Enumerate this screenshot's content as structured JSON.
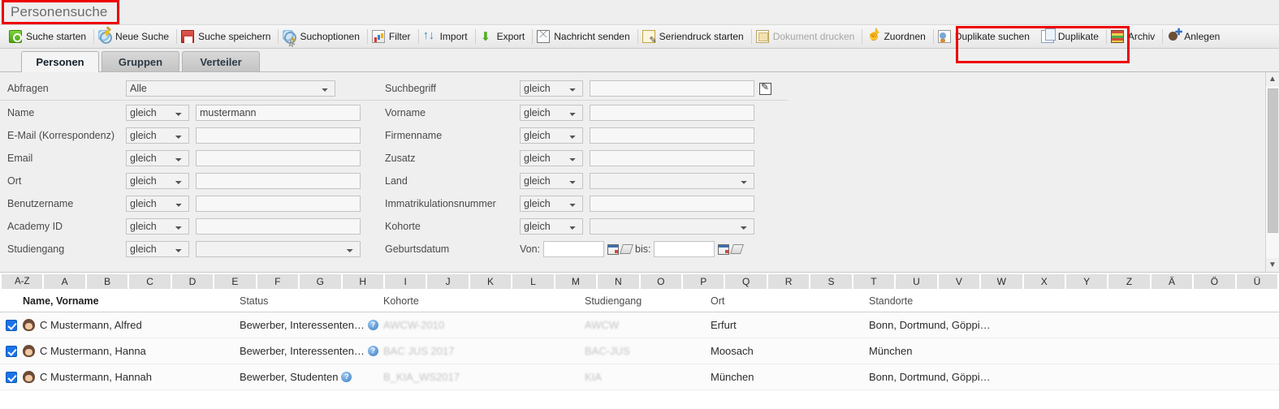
{
  "page": {
    "title": "Personensuche",
    "accent_red": "#ee0000"
  },
  "toolbar": {
    "items": [
      {
        "label": "Suche starten",
        "icon": "search-start-icon",
        "disabled": false,
        "sep_after": true
      },
      {
        "label": "Neue Suche",
        "icon": "new-search-icon",
        "disabled": false,
        "sep_after": true
      },
      {
        "label": "Suche speichern",
        "icon": "save-search-icon",
        "disabled": false,
        "sep_after": true
      },
      {
        "label": "Suchoptionen",
        "icon": "search-options-icon",
        "disabled": false,
        "sep_after": true
      },
      {
        "label": "Filter",
        "icon": "filter-icon",
        "disabled": false,
        "sep_after": true
      },
      {
        "label": "Import",
        "icon": "import-icon",
        "disabled": false,
        "sep_after": true
      },
      {
        "label": "Export",
        "icon": "export-icon",
        "disabled": false,
        "sep_after": true
      },
      {
        "label": "Nachricht senden",
        "icon": "send-message-icon",
        "disabled": false,
        "sep_after": true
      },
      {
        "label": "Seriendruck starten",
        "icon": "mail-merge-icon",
        "disabled": false,
        "sep_after": true
      },
      {
        "label": "Dokument drucken",
        "icon": "print-document-icon",
        "disabled": true,
        "sep_after": true
      },
      {
        "label": "Zuordnen",
        "icon": "assign-icon",
        "disabled": false,
        "sep_after": true
      },
      {
        "label": "Duplikate suchen",
        "icon": "find-duplicates-icon",
        "disabled": false,
        "sep_after": false
      },
      {
        "label": "Duplikate",
        "icon": "duplicates-icon",
        "disabled": false,
        "sep_after": true
      },
      {
        "label": "Archiv",
        "icon": "archive-icon",
        "disabled": false,
        "sep_after": true
      },
      {
        "label": "Anlegen",
        "icon": "create-person-icon",
        "disabled": false,
        "sep_after": false
      }
    ]
  },
  "tabs": [
    {
      "label": "Personen",
      "active": true
    },
    {
      "label": "Gruppen",
      "active": false
    },
    {
      "label": "Verteiler",
      "active": false
    }
  ],
  "form": {
    "abfragen": {
      "label": "Abfragen",
      "value": "Alle"
    },
    "suchbegriff": {
      "label": "Suchbegriff",
      "operator": "gleich",
      "value": ""
    },
    "operator_default": "gleich",
    "left_fields": [
      {
        "label": "Name",
        "operator": "gleich",
        "value": "mustermann",
        "type": "text"
      },
      {
        "label": "E-Mail (Korrespondenz)",
        "operator": "gleich",
        "value": "",
        "type": "text"
      },
      {
        "label": "Email",
        "operator": "gleich",
        "value": "",
        "type": "text"
      },
      {
        "label": "Ort",
        "operator": "gleich",
        "value": "",
        "type": "text"
      },
      {
        "label": "Benutzername",
        "operator": "gleich",
        "value": "",
        "type": "text"
      },
      {
        "label": "Academy ID",
        "operator": "gleich",
        "value": "",
        "type": "text"
      },
      {
        "label": "Studiengang",
        "operator": "gleich",
        "value": "",
        "type": "select"
      }
    ],
    "right_fields": [
      {
        "label": "Vorname",
        "operator": "gleich",
        "value": "",
        "type": "text"
      },
      {
        "label": "Firmenname",
        "operator": "gleich",
        "value": "",
        "type": "text"
      },
      {
        "label": "Zusatz",
        "operator": "gleich",
        "value": "",
        "type": "text"
      },
      {
        "label": "Land",
        "operator": "gleich",
        "value": "",
        "type": "select"
      },
      {
        "label": "Immatrikulationsnummer",
        "operator": "gleich",
        "value": "",
        "type": "text"
      },
      {
        "label": "Kohorte",
        "operator": "gleich",
        "value": "",
        "type": "select"
      }
    ],
    "geburtsdatum": {
      "label": "Geburtsdatum",
      "von_label": "Von:",
      "von_value": "",
      "bis_label": "bis:",
      "bis_value": ""
    }
  },
  "alphabet": [
    "A-Z",
    "A",
    "B",
    "C",
    "D",
    "E",
    "F",
    "G",
    "H",
    "I",
    "J",
    "K",
    "L",
    "M",
    "N",
    "O",
    "P",
    "Q",
    "R",
    "S",
    "T",
    "U",
    "V",
    "W",
    "X",
    "Y",
    "Z",
    "Ä",
    "Ö",
    "Ü"
  ],
  "table": {
    "columns": [
      "Name, Vorname",
      "Status",
      "Kohorte",
      "Studiengang",
      "Ort",
      "Standorte"
    ],
    "rows": [
      {
        "checked": true,
        "name": "C Mustermann, Alfred",
        "status": "Bewerber, Interessenten…",
        "kohorte": "AWCW-2010",
        "studiengang": "AWCW",
        "ort": "Erfurt",
        "standorte": "Bonn, Dortmund, Göppi…"
      },
      {
        "checked": true,
        "name": "C Mustermann, Hanna",
        "status": "Bewerber, Interessenten…",
        "kohorte": "BAC JUS 2017",
        "studiengang": "BAC-JUS",
        "ort": "Moosach",
        "standorte": "München"
      },
      {
        "checked": true,
        "name": "C Mustermann, Hannah",
        "status": "Bewerber, Studenten",
        "kohorte": "B_KIA_WS2017",
        "studiengang": "KIA",
        "ort": "München",
        "standorte": "Bonn, Dortmund, Göppi…"
      }
    ]
  }
}
